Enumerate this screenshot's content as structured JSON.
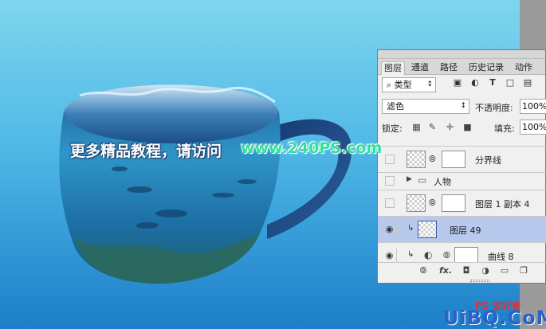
{
  "colors": {
    "accent_selection": "#b8c9ee",
    "panel_bg": "#f0f0f0",
    "watermark_url": "#2fe0a0",
    "logo_blue": "#2a62c5"
  },
  "overlay": {
    "headline_cn": "更多精品教程，请访问",
    "headline_url": "www.240PS.com"
  },
  "layers_panel": {
    "tabs": [
      "图层",
      "通道",
      "路径",
      "历史记录",
      "动作"
    ],
    "active_tab": "图层",
    "filter_type": "类型",
    "filter_icons": [
      "image-filter-icon",
      "adjustment-filter-icon",
      "text-filter-icon",
      "shape-filter-icon",
      "smart-object-filter-icon"
    ],
    "blend_mode": "滤色",
    "opacity_label": "不透明度:",
    "opacity_value": "100%",
    "lock_label": "锁定:",
    "fill_label": "填充:",
    "fill_value": "100%",
    "layers": [
      {
        "name": "分界线",
        "visible": false,
        "type": "smart-with-mask"
      },
      {
        "name": "人物",
        "visible": false,
        "type": "group"
      },
      {
        "name": "图层 1 副本 4",
        "visible": false,
        "type": "layer-with-mask"
      },
      {
        "name": "图层 49",
        "visible": true,
        "type": "clipped-layer",
        "selected": true
      },
      {
        "name": "曲线 8",
        "visible": true,
        "type": "clipped-adjustment"
      }
    ],
    "bottom_icons": [
      "link-layers-icon",
      "fx-icon",
      "add-mask-icon",
      "adjustment-icon",
      "new-group-icon",
      "new-layer-icon"
    ],
    "fx_label": "fx."
  },
  "logo": {
    "top": "PS 爱好者",
    "main": "UiBQ.CoM"
  }
}
